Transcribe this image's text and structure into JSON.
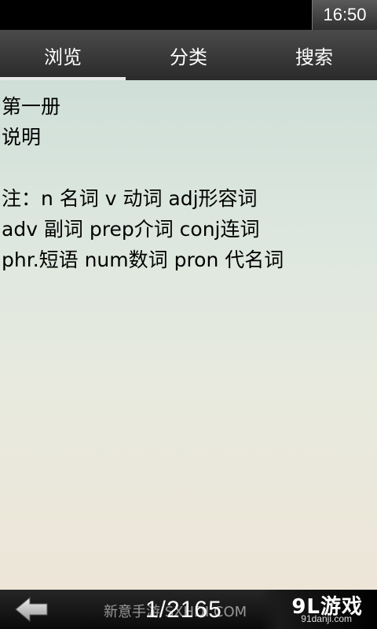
{
  "status_bar": {
    "time": "16:50"
  },
  "tabs": [
    {
      "label": "浏览",
      "active": true
    },
    {
      "label": "分类",
      "active": false
    },
    {
      "label": "搜索",
      "active": false
    }
  ],
  "content": {
    "lines": [
      "第一册",
      "说明",
      "",
      "注：n 名词 v 动词 adj形容词",
      "adv 副词 prep介词 conj连词",
      "phr.短语 num数词 pron 代名词"
    ]
  },
  "bottom_bar": {
    "back_icon": "back-arrow-icon",
    "page_indicator": "1/2165",
    "watermark": "新意手游 SXHDI.COM"
  },
  "logo": {
    "brand": "9L游戏",
    "domain": "91danji.com"
  }
}
